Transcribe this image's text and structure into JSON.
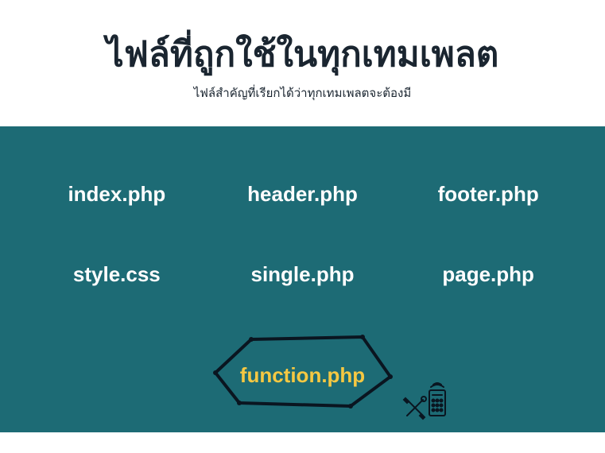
{
  "header": {
    "title": "ไฟล์ที่ถูกใช้ในทุกเทมเพลต",
    "subtitle": "ไฟล์สำคัญที่เรียกได้ว่าทุกเทมเพลตจะต้องมี"
  },
  "files": [
    "index.php",
    "header.php",
    "footer.php",
    "style.css",
    "single.php",
    "page.php"
  ],
  "highlighted_file": "function.php",
  "colors": {
    "background_teal": "#1d6b75",
    "text_dark": "#1a2530",
    "text_white": "#ffffff",
    "highlight_yellow": "#f5c842"
  }
}
